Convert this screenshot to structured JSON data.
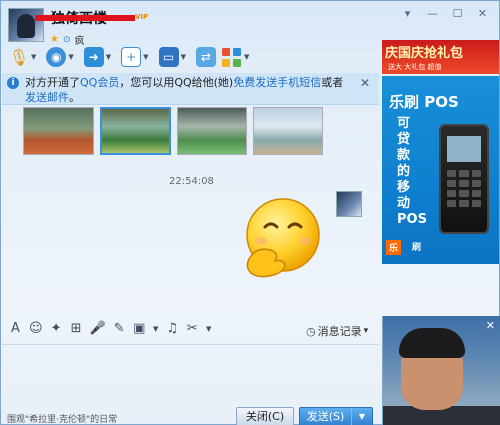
{
  "header": {
    "contact_name": "独倚西楼",
    "vip_badge": "VIP",
    "signature_short": "疯",
    "window_controls": [
      "▾",
      "—",
      "☐",
      "✕"
    ]
  },
  "toolbar": {
    "items": [
      {
        "name": "voice-call",
        "icon": "microphone-icon"
      },
      {
        "name": "video-call",
        "icon": "video-icon"
      },
      {
        "name": "send-file",
        "icon": "folder-icon"
      },
      {
        "name": "create-discussion",
        "icon": "add-chat-icon"
      },
      {
        "name": "screen-share",
        "icon": "monitor-icon"
      },
      {
        "name": "remote-assist",
        "icon": "remote-icon"
      },
      {
        "name": "apps",
        "icon": "apps-grid-icon"
      }
    ]
  },
  "notice": {
    "text_prefix": "对方开通了",
    "link1": "QQ会员",
    "text_mid": "，您可以用QQ给他(她)",
    "link2": "免费发送手机短信",
    "text_mid2": "或者",
    "link3": "发送邮件",
    "text_suffix": "。",
    "close": "✕"
  },
  "chat": {
    "timestamp": "22:54:08"
  },
  "input_toolbar": {
    "history_label": "消息记录",
    "history_arrow": "▾"
  },
  "footer": {
    "signature": "围观\"希拉里·克伦顿\"的日常",
    "close_label": "关闭(C)",
    "send_label": "发送(S)",
    "send_arrow": "▼"
  },
  "ads": {
    "top_title": "庆国庆抢礼包",
    "top_sub": "送大 大礼包 超值",
    "main_brand": "乐刷 POS",
    "main_vertical": "可贷款的移动POS",
    "main_logo1": "乐",
    "main_logo2": "刷"
  },
  "video": {
    "close": "✕"
  },
  "colors": {
    "accent": "#2b7bd3",
    "send_button": "#3d8ede",
    "notice_bg": "#cfe5f7",
    "redaction": "#e0131d"
  }
}
